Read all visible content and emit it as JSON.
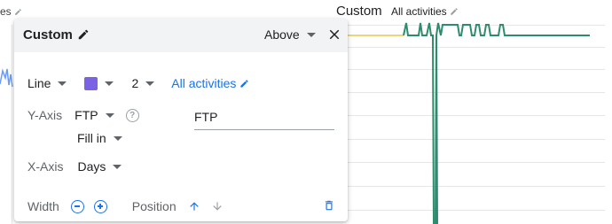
{
  "background": {
    "left_label": "es",
    "chart_title": "Custom",
    "activities_label": "All activities"
  },
  "popup": {
    "title": "Custom",
    "position_select": "Above",
    "line_style": "Line",
    "line_color": "#7b61e4",
    "line_width": "2",
    "activities_link": "All activities",
    "y_axis_label": "Y-Axis",
    "y_axis_metric": "FTP",
    "y_axis_input_value": "FTP",
    "fill_select": "Fill in",
    "x_axis_label": "X-Axis",
    "x_axis_metric": "Days",
    "width_label": "Width",
    "position_label": "Position"
  },
  "colors": {
    "accent": "#1a73e8",
    "series_green": "#2e8b6e",
    "series_yellow": "#e6c84a",
    "series_blue": "#6b9cf0"
  }
}
